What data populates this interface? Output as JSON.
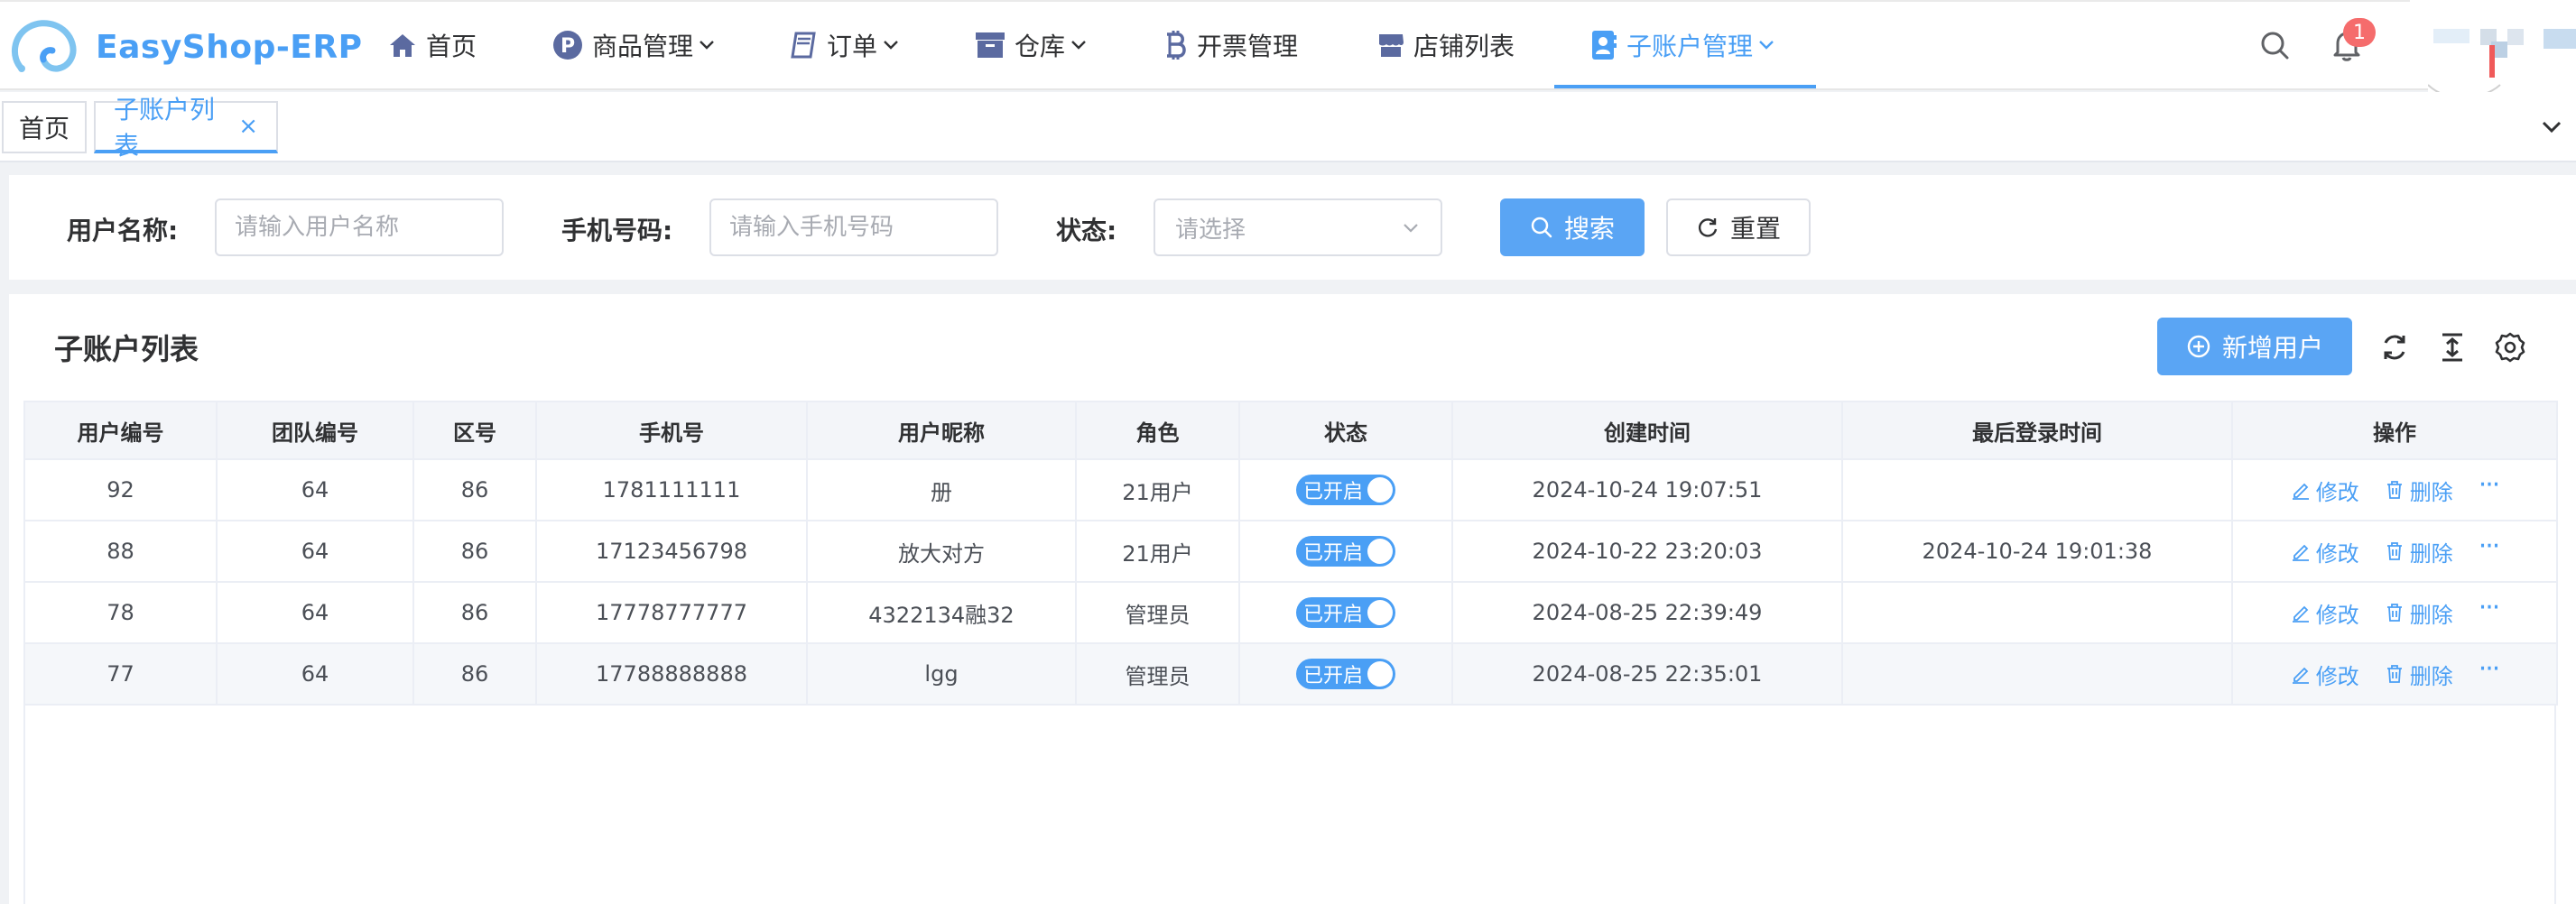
{
  "brand": {
    "name": "EasyShop-ERP",
    "accent": "#4a9ff5"
  },
  "nav": {
    "items": [
      {
        "label": "首页",
        "icon": "home-icon"
      },
      {
        "label": "商品管理",
        "icon": "product-p-icon",
        "dropdown": true
      },
      {
        "label": "订单",
        "icon": "book-icon",
        "dropdown": true
      },
      {
        "label": "仓库",
        "icon": "archive-box-icon",
        "dropdown": true
      },
      {
        "label": "开票管理",
        "icon": "bitcoin-icon"
      },
      {
        "label": "店铺列表",
        "icon": "store-icon"
      },
      {
        "label": "子账户管理",
        "icon": "contact-book-icon",
        "dropdown": true,
        "active": true
      }
    ],
    "notification_count": "1"
  },
  "tabs": {
    "home": "首页",
    "current": "子账户列表",
    "close": "×"
  },
  "search": {
    "username_label": "用户名称:",
    "username_placeholder": "请输入用户名称",
    "phone_label": "手机号码:",
    "phone_placeholder": "请输入手机号码",
    "status_label": "状态:",
    "status_placeholder": "请选择",
    "search_button": "搜索",
    "reset_button": "重置"
  },
  "list": {
    "title": "子账户列表",
    "add_button": "新增用户",
    "columns": [
      "用户编号",
      "团队编号",
      "区号",
      "手机号",
      "用户昵称",
      "角色",
      "状态",
      "创建时间",
      "最后登录时间",
      "操作"
    ],
    "rows": [
      {
        "id": "92",
        "team": "64",
        "area": "86",
        "phone": "1781111111",
        "nickname": "册",
        "role": "21用户",
        "status": "已开启",
        "created": "2024-10-24 19:07:51",
        "last_login": ""
      },
      {
        "id": "88",
        "team": "64",
        "area": "86",
        "phone": "17123456798",
        "nickname": "放大对方",
        "role": "21用户",
        "status": "已开启",
        "created": "2024-10-22 23:20:03",
        "last_login": "2024-10-24 19:01:38"
      },
      {
        "id": "78",
        "team": "64",
        "area": "86",
        "phone": "17778777777",
        "nickname": "4322134融32",
        "role": "管理员",
        "status": "已开启",
        "created": "2024-08-25 22:39:49",
        "last_login": ""
      },
      {
        "id": "77",
        "team": "64",
        "area": "86",
        "phone": "17788888888",
        "nickname": "lgg",
        "role": "管理员",
        "status": "已开启",
        "created": "2024-08-25 22:35:01",
        "last_login": ""
      }
    ],
    "actions": {
      "edit": "修改",
      "delete": "删除",
      "more": "···"
    }
  }
}
